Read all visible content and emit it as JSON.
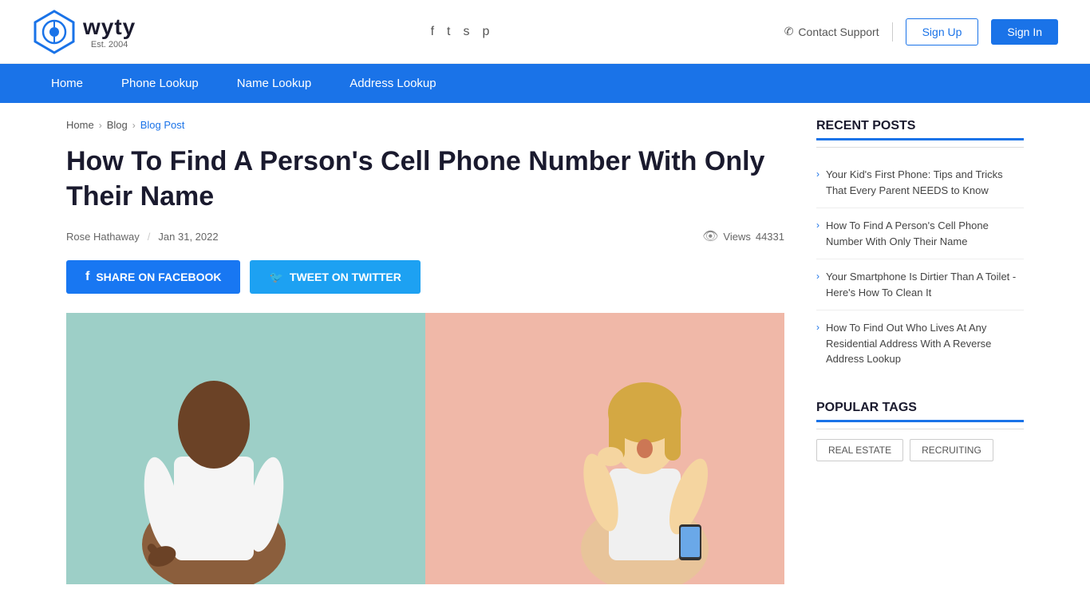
{
  "header": {
    "logo_text": "wyty",
    "logo_est": "Est. 2004",
    "contact_support": "Contact Support",
    "signup_label": "Sign Up",
    "signin_label": "Sign In"
  },
  "nav": {
    "items": [
      {
        "label": "Home",
        "id": "home"
      },
      {
        "label": "Phone Lookup",
        "id": "phone-lookup"
      },
      {
        "label": "Name Lookup",
        "id": "name-lookup"
      },
      {
        "label": "Address Lookup",
        "id": "address-lookup"
      }
    ]
  },
  "breadcrumb": {
    "home": "Home",
    "blog": "Blog",
    "current": "Blog Post"
  },
  "article": {
    "title": "How To Find A Person's Cell Phone Number With Only Their Name",
    "author": "Rose Hathaway",
    "date": "Jan 31, 2022",
    "views_label": "Views",
    "views_count": "44331",
    "share_facebook": "SHARE ON FACEBOOK",
    "share_twitter": "TWEET ON TWITTER"
  },
  "sidebar": {
    "recent_posts_title": "RECENT POSTS",
    "posts": [
      {
        "id": 1,
        "text": "Your Kid's First Phone: Tips and Tricks That Every Parent NEEDS to Know"
      },
      {
        "id": 2,
        "text": "How To Find A Person's Cell Phone Number With Only Their Name"
      },
      {
        "id": 3,
        "text": "Your Smartphone Is Dirtier Than A Toilet - Here's How To Clean It"
      },
      {
        "id": 4,
        "text": "How To Find Out Who Lives At Any Residential Address With A Reverse Address Lookup"
      }
    ],
    "popular_tags_title": "POPULAR TAGS",
    "tags": [
      {
        "id": 1,
        "label": "REAL ESTATE"
      },
      {
        "id": 2,
        "label": "RECRUITING"
      }
    ]
  },
  "icons": {
    "phone_icon": "☎",
    "eye_icon": "👁",
    "facebook_icon": "f",
    "twitter_icon": "t",
    "chevron_right": "›",
    "arrow_right": "❯"
  }
}
